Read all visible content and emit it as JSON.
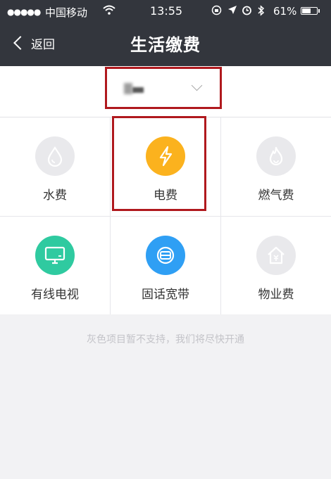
{
  "status_bar": {
    "signal": "●●●●●",
    "carrier": "中国移动",
    "time": "13:55",
    "battery": "61%",
    "battery_level": 0.61
  },
  "nav": {
    "back_label": "返回",
    "title": "生活缴费"
  },
  "services": [
    {
      "label": "水费",
      "icon": "water-drop-icon",
      "color": "#e9e9ec",
      "available": false
    },
    {
      "label": "电费",
      "icon": "lightning-icon",
      "color": "#fbb21e",
      "available": true
    },
    {
      "label": "燃气费",
      "icon": "flame-icon",
      "color": "#e9e9ec",
      "available": false
    },
    {
      "label": "有线电视",
      "icon": "tv-icon",
      "color": "#2fcaa0",
      "available": true
    },
    {
      "label": "固话宽带",
      "icon": "broadband-icon",
      "color": "#2f9ff4",
      "available": true
    },
    {
      "label": "物业费",
      "icon": "house-icon",
      "color": "#e9e9ec",
      "available": false
    }
  ],
  "notice": "灰色项目暂不支持，我们将尽快开通",
  "colors": {
    "header_bg": "#33363d",
    "highlight": "#b0191e"
  }
}
